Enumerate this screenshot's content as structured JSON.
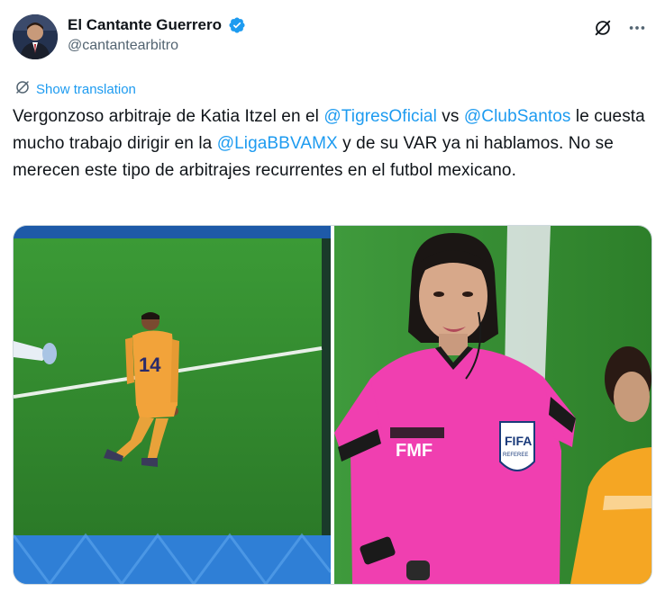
{
  "author": {
    "display_name": "El Cantante Guerrero",
    "handle": "@cantantearbitro",
    "avatar_icon": "user-avatar",
    "verified_icon": "verified-badge-icon",
    "verified_color": "#1d9bf0"
  },
  "actions": {
    "grok_icon": "grok-icon",
    "more_icon": "more-options-icon"
  },
  "translate": {
    "label": "Show translation",
    "icon": "globe-icon"
  },
  "tweet": {
    "seg1": "Vergonzoso arbitraje de Katia Itzel en el ",
    "mention1": "@TigresOficial",
    "seg2": " vs ",
    "mention2": "@ClubSantos",
    "seg3": " le cuesta mucho trabajo dirigir en la ",
    "mention3": "@LigaBBVAMX",
    "seg4": " y de su VAR ya ni hablamos. No se merecen este tipo de arbitrajes recurrentes en el futbol mexicano."
  },
  "media": {
    "photo1": {
      "jersey_number": "14"
    },
    "photo2": {
      "logo_text": "FMF",
      "badge_text": "FIFA",
      "badge_sub": "REFEREE"
    }
  },
  "colors": {
    "link": "#1d9bf0",
    "text": "#0f1419",
    "secondary": "#536471",
    "pitch": "#2f8a2c",
    "referee_pink": "#f03fb0",
    "tigres_yellow": "#f5a623"
  }
}
